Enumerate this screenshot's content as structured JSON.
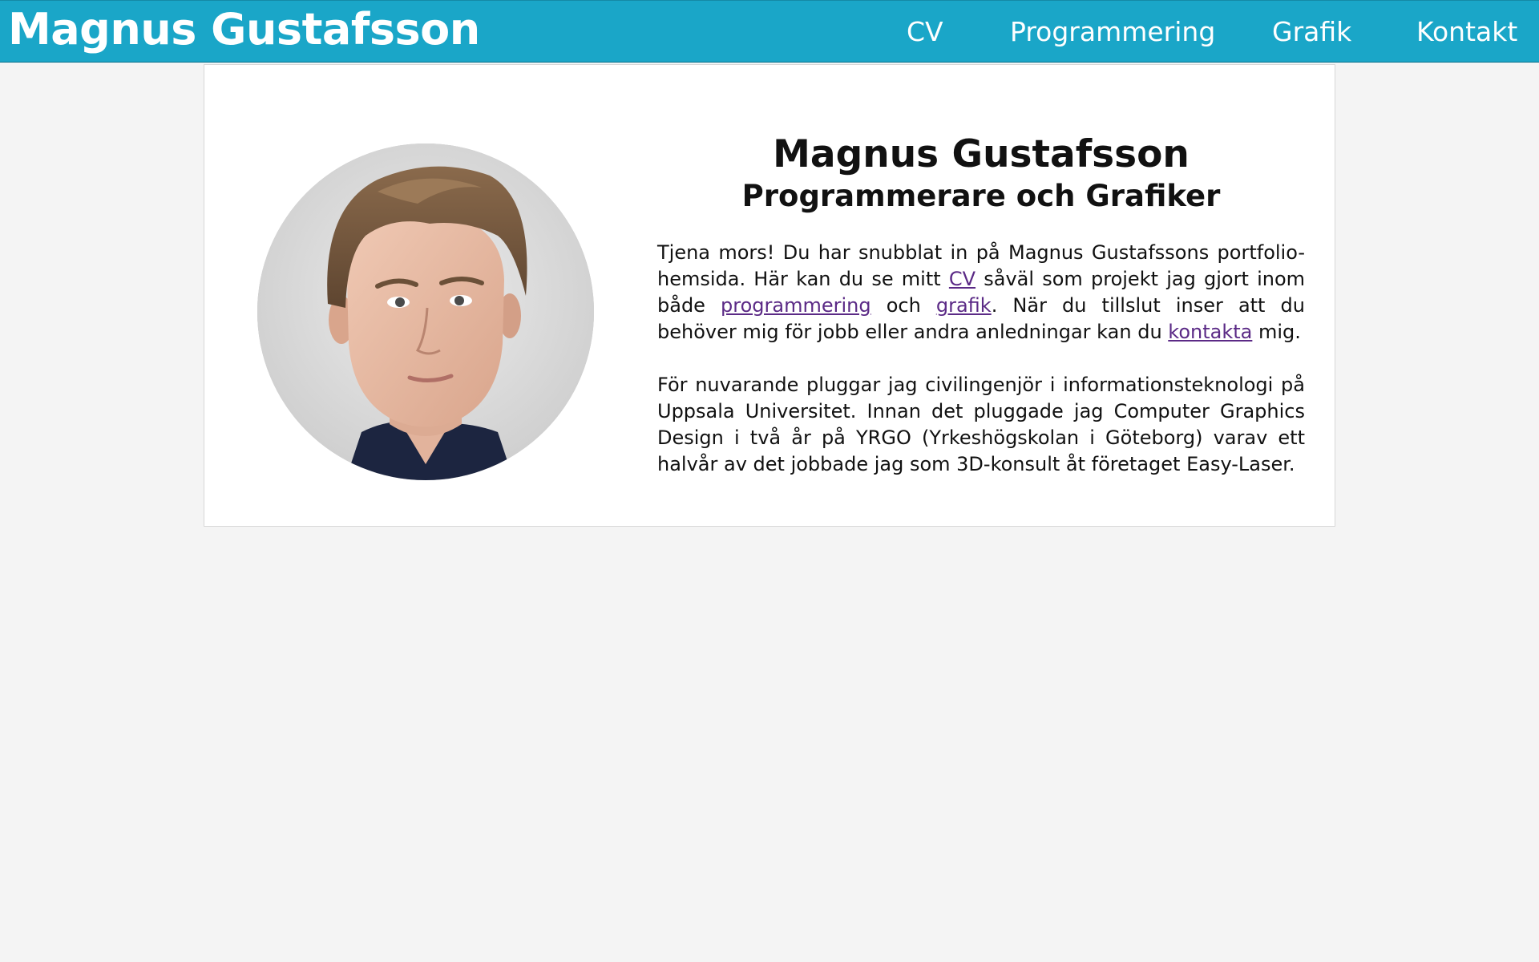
{
  "header": {
    "site_title": "Magnus Gustafsson",
    "nav": [
      {
        "label": "CV"
      },
      {
        "label": "Programmering"
      },
      {
        "label": "Grafik"
      },
      {
        "label": "Kontakt"
      }
    ],
    "bar_color": "#1aa6c8"
  },
  "profile": {
    "name": "Magnus Gustafsson",
    "role": "Programmerare och Grafiker",
    "paragraph1": {
      "t1": "Tjena mors! Du har snubblat in på Magnus Gustafssons portfolio-hemsida. Här kan du se mitt ",
      "link_cv": "CV",
      "t2": " såväl som projekt jag gjort inom både ",
      "link_programmering": "programmering",
      "t3": " och ",
      "link_grafik": "grafik",
      "t4": ". När du tillslut inser att du behöver mig för jobb eller andra anledningar kan du ",
      "link_kontakta": "kontakta",
      "t5": " mig."
    },
    "paragraph2": "För nuvarande pluggar jag civilingenjör i informationsteknologi på Uppsala Universitet. Innan det pluggade jag Computer Graphics Design i två år på YRGO (Yrkeshögskolan i Göteborg) varav ett halvår av det jobbade jag som 3D-konsult åt företaget Easy-Laser.",
    "link_color": "#5b2a86",
    "portrait_icon": "portrait-photo"
  }
}
